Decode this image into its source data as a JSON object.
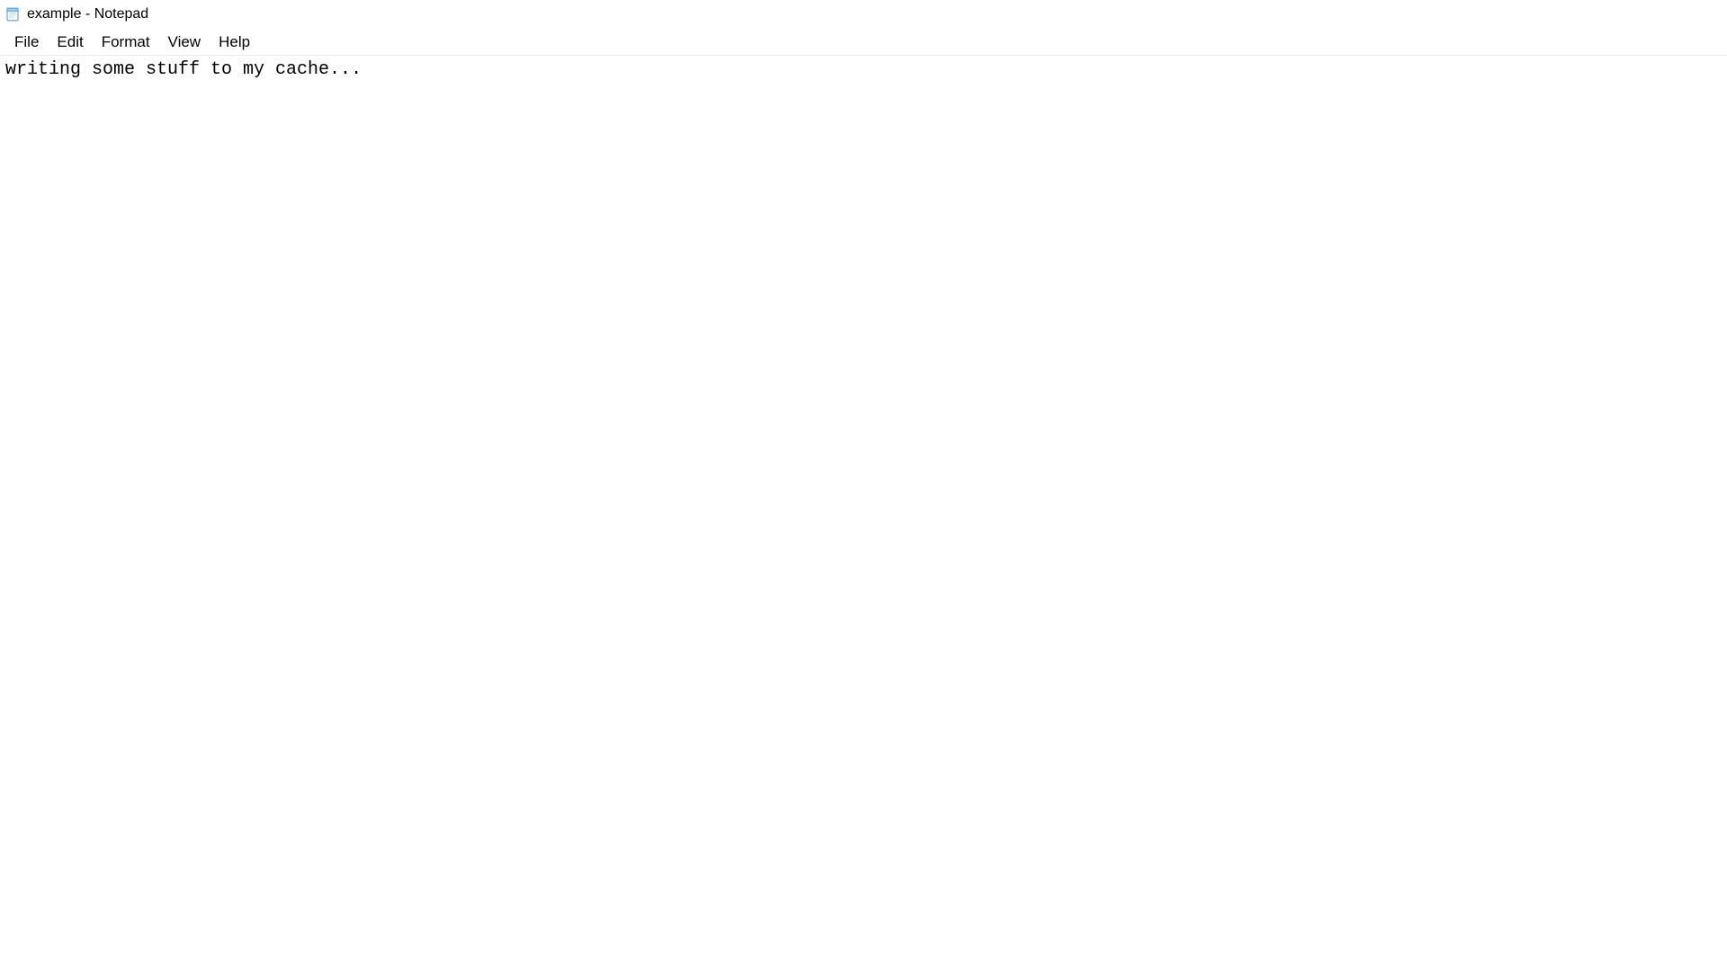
{
  "window": {
    "title": "example - Notepad"
  },
  "menu": {
    "items": [
      {
        "label": "File"
      },
      {
        "label": "Edit"
      },
      {
        "label": "Format"
      },
      {
        "label": "View"
      },
      {
        "label": "Help"
      }
    ]
  },
  "editor": {
    "content": "writing some stuff to my cache..."
  }
}
